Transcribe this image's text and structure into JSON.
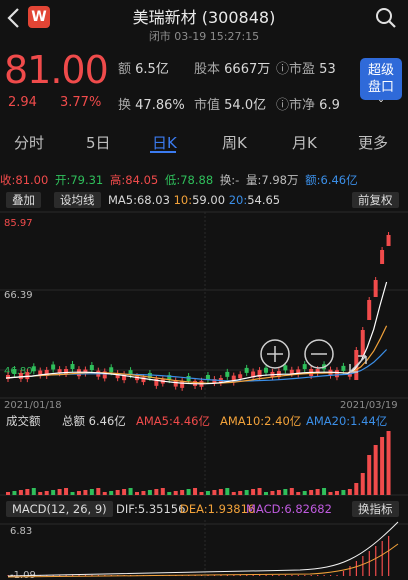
{
  "header": {
    "title": "美瑞新材 (300848)",
    "status": "闭市 03-19 15:27:15",
    "logo_letter": "W"
  },
  "quote": {
    "price": "81.00",
    "change": "2.94",
    "change_pct": "3.77%",
    "stats": [
      {
        "k": "额",
        "v": "6.5亿"
      },
      {
        "k": "股本",
        "v": "6667万"
      },
      {
        "k": "市盈",
        "v": "53"
      },
      {
        "k": "换",
        "v": "47.86%"
      },
      {
        "k": "市值",
        "v": "54.0亿"
      },
      {
        "k": "市净",
        "v": "6.9"
      }
    ],
    "super_button": {
      "line1": "超级",
      "line2": "盘口",
      "chev": "⌄"
    }
  },
  "tabs": [
    "分时",
    "5日",
    "日K",
    "周K",
    "月K",
    "更多"
  ],
  "active_tab": "日K",
  "ohlc": {
    "shou": "收:81.00",
    "kai": "开:79.31",
    "gao": "高:84.05",
    "di": "低:78.88",
    "huan": "换:-",
    "liang": "量:7.98万",
    "e": "额:6.46亿"
  },
  "ma_row": {
    "overlay_btn": "叠加",
    "set_btn": "设均线",
    "ma5_label": "MA5:",
    "ma5": "68.03",
    "ma10_label": "10:",
    "ma10": "59.00",
    "ma20_label": "20:",
    "ma20": "54.65",
    "adjust_btn": "前复权"
  },
  "price_chart": {
    "y_max_label": "85.97",
    "y_mid_label": "66.39",
    "y_low_label": "46.80",
    "date_start": "2021/01/18",
    "date_end": "2021/03/19",
    "colors": {
      "up": "#f04b4b",
      "down": "#2fbf5b",
      "ma5": "#ffffff",
      "ma10": "#f2a23a",
      "ma20": "#3b8fe8"
    }
  },
  "volume": {
    "title": "成交额",
    "total": "总额 6.46亿",
    "ama5": "AMA5:4.46亿",
    "ama10": "AMA10:2.40亿",
    "ama20": "AMA20:1.44亿"
  },
  "macd": {
    "title": "MACD(12, 26, 9)",
    "dif": "DIF:5.35156",
    "dea": "DEA:1.93816",
    "macd": "MACD:6.82682",
    "switch_btn": "换指标",
    "top_label": "6.83",
    "bottom_label": "-1.09"
  }
}
